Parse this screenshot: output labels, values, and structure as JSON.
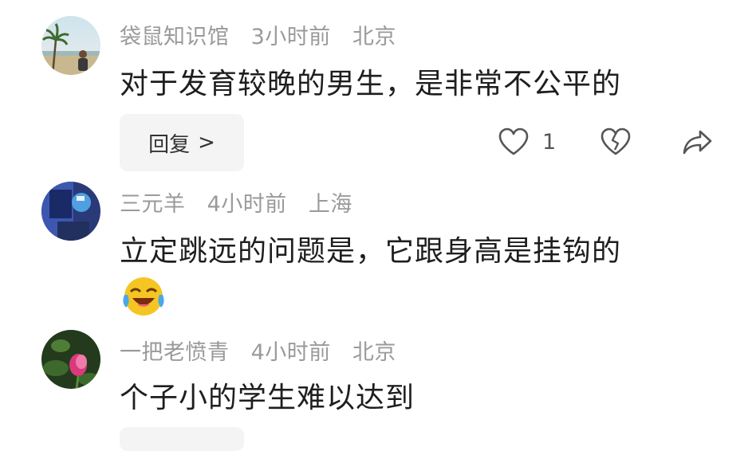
{
  "comments": [
    {
      "username": "袋鼠知识馆",
      "time": "3小时前",
      "location": "北京",
      "text": "对于发育较晚的男生，是非常不公平的",
      "reply_label": "回复",
      "reply_chevron": ">",
      "like_count": "1",
      "avatar": "beach-photo"
    },
    {
      "username": "三元羊",
      "time": "4小时前",
      "location": "上海",
      "text": "立定跳远的问题是，它跟身高是挂钩的",
      "emoji": "laughing-tears-emoji",
      "avatar": "blue-abstract"
    },
    {
      "username": "一把老愤青",
      "time": "4小时前",
      "location": "北京",
      "text": "个子小的学生难以达到",
      "avatar": "pink-flower"
    }
  ],
  "icons": {
    "like": "heart-outline-icon",
    "dislike": "broken-heart-icon",
    "share": "share-arrow-icon"
  },
  "colors": {
    "meta_text": "#9a9a9a",
    "body_text": "#1e1e1e",
    "reply_bg": "#f4f4f4",
    "icon_stroke": "#555555"
  }
}
